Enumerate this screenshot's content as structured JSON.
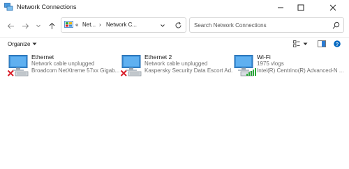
{
  "window": {
    "title": "Network Connections",
    "icon": "network-connections-icon"
  },
  "address": {
    "chevrons": "«",
    "segment1": "Net...",
    "separator": "›",
    "segment2": "Network C..."
  },
  "search": {
    "placeholder": "Search Network Connections"
  },
  "toolbar": {
    "organize_label": "Organize"
  },
  "connections": [
    {
      "name": "Ethernet",
      "status": "Network cable unplugged",
      "device": "Broadcom NetXtreme 57xx Gigab...",
      "state_icon": "disconnected-x-icon"
    },
    {
      "name": "Ethernet 2",
      "status": "Network cable unplugged",
      "device": "Kaspersky Security Data Escort Ad...",
      "state_icon": "disconnected-x-icon"
    },
    {
      "name": "Wi-Fi",
      "status": "1975 vlogs",
      "device": "Intel(R) Centrino(R) Advanced-N ...",
      "state_icon": "wifi-signal-icon"
    }
  ],
  "colors": {
    "accent": "#0067c0",
    "error": "#d9202b",
    "signal": "#2aa838",
    "monitor": "#3a8fd8"
  }
}
